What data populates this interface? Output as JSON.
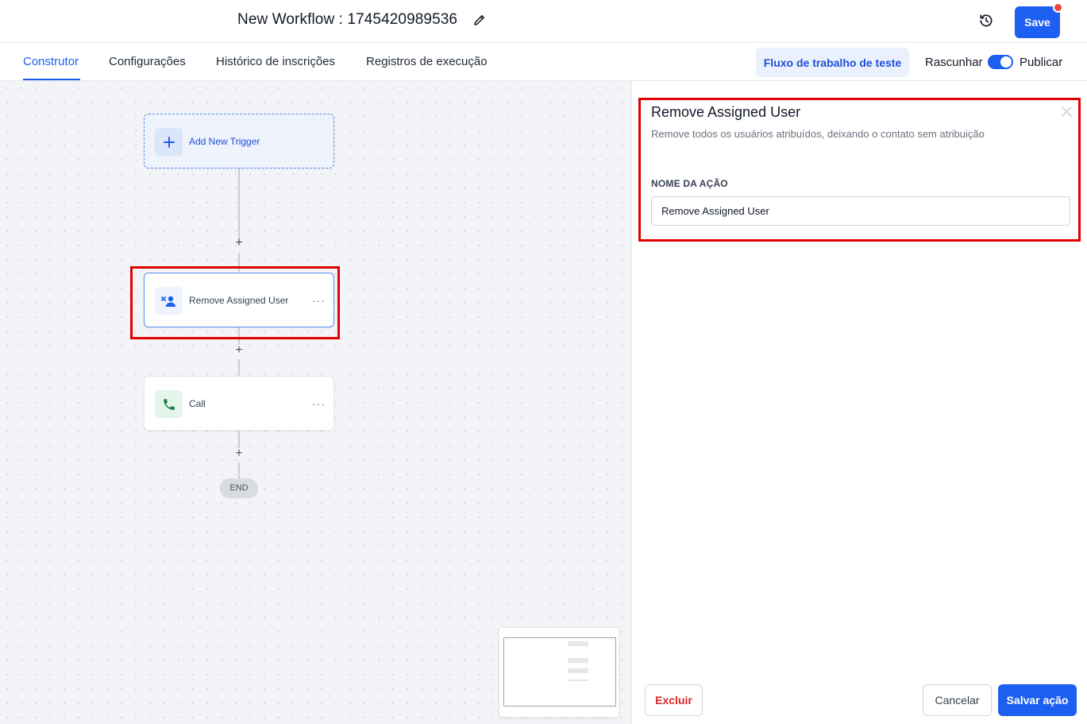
{
  "header": {
    "workflow_title": "New Workflow : 1745420989536",
    "save_label": "Save",
    "edit_icon": "pencil-icon",
    "history_icon": "history-icon"
  },
  "tabs": [
    {
      "label": "Construtor",
      "active": true
    },
    {
      "label": "Configurações",
      "active": false
    },
    {
      "label": "Histórico de inscrições",
      "active": false
    },
    {
      "label": "Registros de execução",
      "active": false
    }
  ],
  "toolbar": {
    "test_label": "Fluxo de trabalho de teste",
    "draft_label": "Rascunhar",
    "publish_label": "Publicar",
    "published": true
  },
  "canvas": {
    "trigger_label": "Add New Trigger",
    "nodes": [
      {
        "label": "Remove Assigned User",
        "icon": "remove-user-icon"
      },
      {
        "label": "Call",
        "icon": "phone-icon"
      }
    ],
    "add_symbol": "+",
    "more_symbol": "···",
    "end_label": "END"
  },
  "panel": {
    "title": "Remove Assigned User",
    "description": "Remove todos os usuários atribuídos, deixando o contato sem atribuição",
    "field_label": "NOME DA AÇÃO",
    "field_value": "Remove Assigned User",
    "delete_label": "Excluir",
    "cancel_label": "Cancelar",
    "save_label": "Salvar ação"
  },
  "colors": {
    "accent": "#1d5ff0",
    "highlight": "#e00000",
    "danger": "#dc2626",
    "call_icon": "#15803d"
  }
}
